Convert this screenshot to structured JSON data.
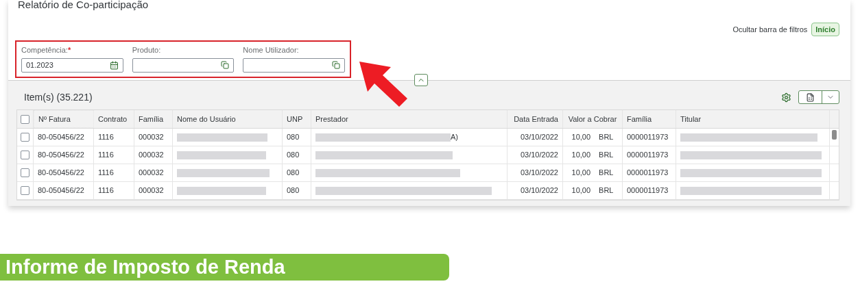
{
  "page_title": "Relatório de Co-participação",
  "filters": [
    {
      "label": "Competência:",
      "required_mark": "*",
      "value": "01.2023",
      "kind": "date"
    },
    {
      "label": "Produto:",
      "kind": "valuehelp"
    },
    {
      "label": "Nome Utilizador:",
      "kind": "valuehelp"
    }
  ],
  "filter_actions": {
    "hide_link": "Ocultar barra de filtros",
    "go_button": "Início"
  },
  "table": {
    "title": "Item(s) (35.221)",
    "all_selected": false,
    "columns": [
      {
        "label": "Nº Fatura",
        "kind": "text"
      },
      {
        "label": "Contrato",
        "kind": "text"
      },
      {
        "label": "Família",
        "kind": "text"
      },
      {
        "label": "Nome do Usuário",
        "kind": "redacted"
      },
      {
        "label": "UNP",
        "kind": "text"
      },
      {
        "label": "Prestador",
        "kind": "redacted"
      },
      {
        "label": "Data Entrada",
        "kind": "right"
      },
      {
        "label": "Valor a Cobrar",
        "kind": "amount"
      },
      {
        "label": "Família",
        "kind": "text"
      },
      {
        "label": "Titular",
        "kind": "redacted"
      }
    ],
    "rows": [
      {
        "selected": false,
        "cells": [
          "80-050456/22",
          "1116",
          "000032",
          null,
          "080",
          "A)",
          "03/10/2022",
          [
            "10,00",
            "BRL"
          ],
          "0000011973",
          null
        ]
      },
      {
        "selected": false,
        "cells": [
          "80-050456/22",
          "1116",
          "000032",
          null,
          "080",
          null,
          "03/10/2022",
          [
            "10,00",
            "BRL"
          ],
          "0000011973",
          null
        ]
      },
      {
        "selected": false,
        "cells": [
          "80-050456/22",
          "1116",
          "000032",
          null,
          "080",
          null,
          "03/10/2022",
          [
            "10,00",
            "BRL"
          ],
          "0000011973",
          null
        ]
      },
      {
        "selected": false,
        "cells": [
          "80-050456/22",
          "1116",
          "000032",
          null,
          "080",
          null,
          "03/10/2022",
          [
            "10,00",
            "BRL"
          ],
          "0000011973",
          null
        ]
      }
    ]
  },
  "banner": {
    "title": "Informe de Imposto de Renda"
  }
}
